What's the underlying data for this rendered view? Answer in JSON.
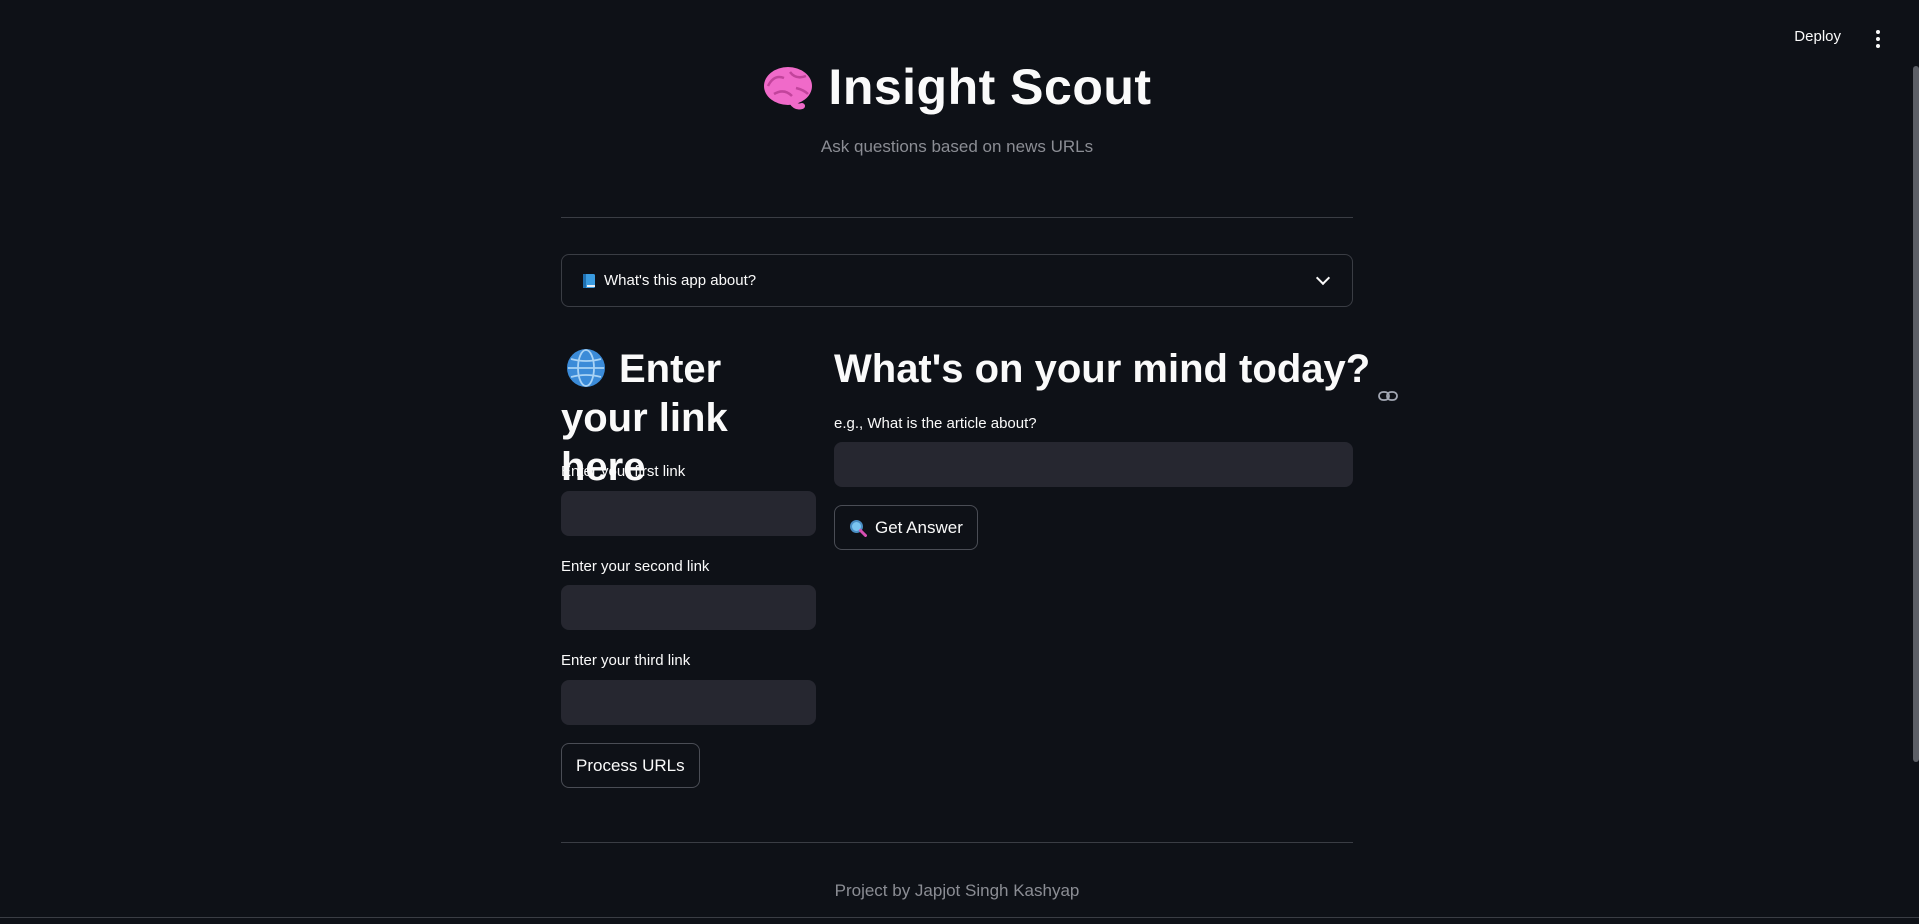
{
  "toolbar": {
    "deploy_label": "Deploy",
    "menu_icon": "kebab-menu-icon"
  },
  "header": {
    "icon": "brain-icon",
    "title": "Insight Scout",
    "subtitle": "Ask questions based on news URLs"
  },
  "expander": {
    "icon": "blue-book-icon",
    "label": "What's this app about?",
    "chevron_icon": "chevron-down-icon"
  },
  "links_section": {
    "icon": "globe-icon",
    "heading": "Enter your link here",
    "fields": [
      {
        "label": "Enter your first link",
        "value": ""
      },
      {
        "label": "Enter your second link",
        "value": ""
      },
      {
        "label": "Enter your third link",
        "value": ""
      }
    ],
    "process_button_label": "Process URLs"
  },
  "question_section": {
    "heading": "What's on your mind today?",
    "anchor_icon": "link-icon",
    "input_label": "e.g., What is the article about?",
    "input_value": "",
    "button_icon": "magnifying-glass-icon",
    "button_label": "Get Answer"
  },
  "footer": {
    "text": "Project by Japjot Singh Kashyap"
  },
  "colors": {
    "background": "#0e1117",
    "input_background": "#262730",
    "border": "#3a3d44",
    "muted_text": "#8b8d94",
    "text": "#fafafa"
  }
}
